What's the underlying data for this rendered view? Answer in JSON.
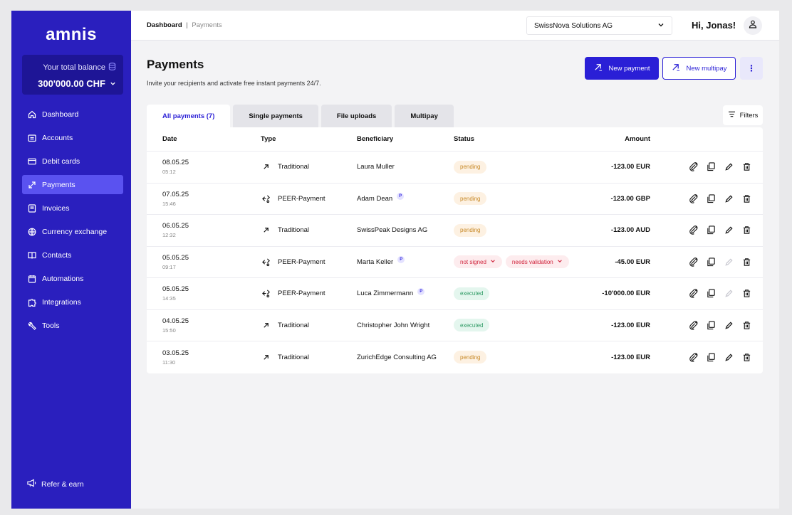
{
  "sidebar": {
    "logo": "amnis",
    "balance_label": "Your total balance",
    "balance_amount": "300'000.00 CHF",
    "items": [
      {
        "label": "Dashboard",
        "icon": "home-icon",
        "active": false
      },
      {
        "label": "Accounts",
        "icon": "wallet-icon",
        "active": false
      },
      {
        "label": "Debit cards",
        "icon": "card-icon",
        "active": false
      },
      {
        "label": "Payments",
        "icon": "arrows-icon",
        "active": true
      },
      {
        "label": "Invoices",
        "icon": "invoice-icon",
        "active": false
      },
      {
        "label": "Currency exchange",
        "icon": "exchange-icon",
        "active": false
      },
      {
        "label": "Contacts",
        "icon": "book-icon",
        "active": false
      },
      {
        "label": "Automations",
        "icon": "calendar-icon",
        "active": false
      },
      {
        "label": "Integrations",
        "icon": "puzzle-icon",
        "active": false
      },
      {
        "label": "Tools",
        "icon": "tools-icon",
        "active": false
      }
    ],
    "refer": "Refer & earn"
  },
  "header": {
    "breadcrumb_current": "Dashboard",
    "breadcrumb_sep": "|",
    "breadcrumb_page": "Payments",
    "company": "SwissNova Solutions AG",
    "greeting": "Hi, Jonas!"
  },
  "page": {
    "title": "Payments",
    "subtitle": "Invite your recipients and activate free instant payments 24/7.",
    "new_payment": "New payment",
    "new_multipay": "New multipay",
    "more": "⋮",
    "filters": "Filters"
  },
  "tabs": [
    "All payments (7)",
    "Single payments",
    "File uploads",
    "Multipay"
  ],
  "table": {
    "headers": {
      "date": "Date",
      "type": "Type",
      "beneficiary": "Beneficiary",
      "status": "Status",
      "amount": "Amount"
    },
    "rows": [
      {
        "date": "08.05.25",
        "time": "05:12",
        "type": "Traditional",
        "beneficiary": "Laura Muller",
        "peer": false,
        "statuses": [
          {
            "label": "pending",
            "kind": "pending"
          }
        ],
        "amount": "-123.00 EUR",
        "edit_enabled": true
      },
      {
        "date": "07.05.25",
        "time": "15:46",
        "type": "PEER-Payment",
        "beneficiary": "Adam Dean",
        "peer": true,
        "statuses": [
          {
            "label": "pending",
            "kind": "pending"
          }
        ],
        "amount": "-123.00 GBP",
        "edit_enabled": true
      },
      {
        "date": "06.05.25",
        "time": "12:32",
        "type": "Traditional",
        "beneficiary": "SwissPeak Designs AG",
        "peer": false,
        "statuses": [
          {
            "label": "pending",
            "kind": "pending"
          }
        ],
        "amount": "-123.00 AUD",
        "edit_enabled": true
      },
      {
        "date": "05.05.25",
        "time": "09:17",
        "type": "PEER-Payment",
        "beneficiary": "Marta Keller",
        "peer": true,
        "statuses": [
          {
            "label": "not signed",
            "kind": "red"
          },
          {
            "label": "needs validation",
            "kind": "red"
          }
        ],
        "amount": "-45.00 EUR",
        "edit_enabled": false
      },
      {
        "date": "05.05.25",
        "time": "14:35",
        "type": "PEER-Payment",
        "beneficiary": "Luca Zimmermann",
        "peer": true,
        "statuses": [
          {
            "label": "executed",
            "kind": "executed"
          }
        ],
        "amount": "-10'000.00 EUR",
        "edit_enabled": false
      },
      {
        "date": "04.05.25",
        "time": "15:50",
        "type": "Traditional",
        "beneficiary": "Christopher John Wright",
        "peer": false,
        "statuses": [
          {
            "label": "executed",
            "kind": "executed"
          }
        ],
        "amount": "-123.00 EUR",
        "edit_enabled": true
      },
      {
        "date": "03.05.25",
        "time": "11:30",
        "type": "Traditional",
        "beneficiary": "ZurichEdge Consulting AG",
        "peer": false,
        "statuses": [
          {
            "label": "pending",
            "kind": "pending"
          }
        ],
        "amount": "-123.00 EUR",
        "edit_enabled": true
      }
    ],
    "peer_badge": "P"
  },
  "colors": {
    "brand": "#2a1fbe",
    "accent": "#2a1fd6",
    "active_nav": "#5a52f0"
  }
}
